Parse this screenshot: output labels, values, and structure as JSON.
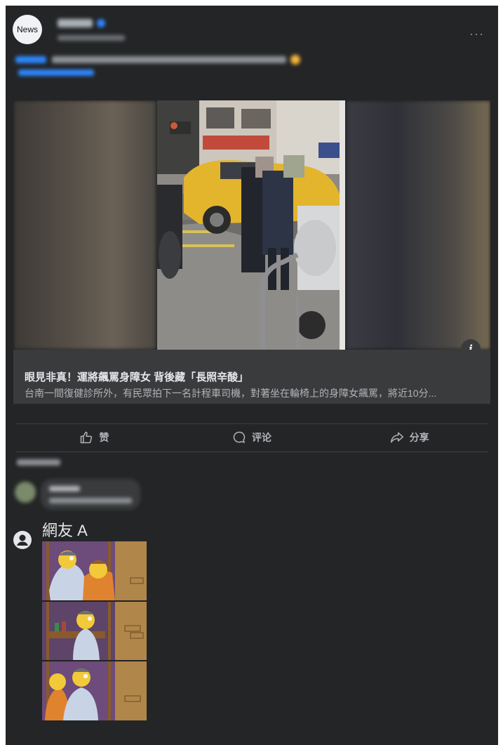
{
  "post": {
    "avatar_text": "News",
    "more_label": "···"
  },
  "media": {
    "info_label": "i",
    "title": "眼見非真！運將飆罵身障女 背後藏「長照辛酸」",
    "description": "台南一間復健診所外，有民眾拍下一名計程車司機，對著坐在輪椅上的身障女飆罵，將近10分..."
  },
  "actions": {
    "like": "赞",
    "comment": "评论",
    "share": "分享"
  },
  "comment": {
    "author": "網友 A"
  },
  "colors": {
    "background": "#242526",
    "caption_bg": "#3a3b3c",
    "text_primary": "#e4e6eb",
    "text_secondary": "#b0b3b8",
    "link_blue": "#2d88ff"
  }
}
